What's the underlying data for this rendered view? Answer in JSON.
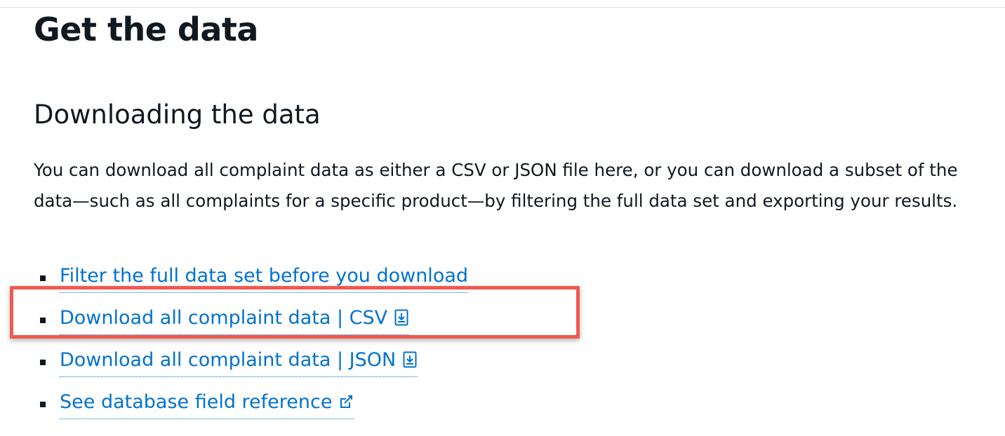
{
  "page": {
    "title": "Get the data",
    "section_heading": "Downloading the data",
    "intro": "You can download all complaint data as either a CSV or JSON file here, or you can download a subset of the data—such as all complaints for a specific product—by filtering the full data set and exporting your results."
  },
  "links": [
    {
      "label": "Filter the full data set before you download",
      "icon": null
    },
    {
      "label": "Download all complaint data | CSV",
      "icon": "download-icon"
    },
    {
      "label": "Download all complaint data | JSON",
      "icon": "download-icon"
    },
    {
      "label": "See database field reference",
      "icon": "external-link-icon"
    }
  ],
  "colors": {
    "link": "#0072ce",
    "text": "#101820",
    "highlight": "#f05a50"
  }
}
